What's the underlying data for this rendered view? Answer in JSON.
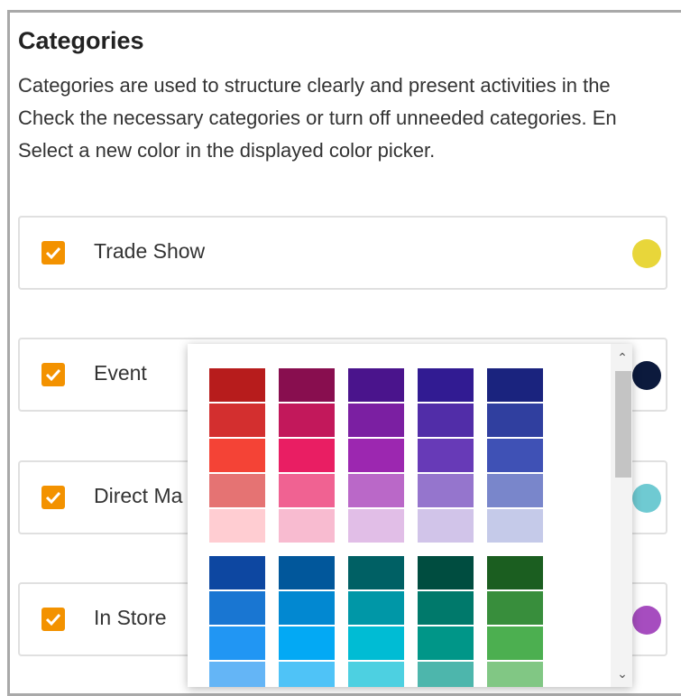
{
  "section": {
    "title": "Categories",
    "description": [
      "Categories are used to structure clearly and present activities in the",
      "Check the necessary categories or turn off unneeded categories. En",
      "Select a new color in the displayed color picker."
    ]
  },
  "categories": [
    {
      "label": "Trade Show",
      "checked": true,
      "color": "#e8d63a"
    },
    {
      "label": "Event",
      "checked": true,
      "color": "#0c1a3d"
    },
    {
      "label": "Direct Ma",
      "checked": true,
      "color": "#6fcad2"
    },
    {
      "label": "In Store",
      "checked": true,
      "color": "#a64dbf"
    }
  ],
  "picker": {
    "group1": [
      [
        "#b71c1c",
        "#d32f2f",
        "#f44336",
        "#e57373",
        "#ffcdd2"
      ],
      [
        "#880e4f",
        "#c2185b",
        "#e91e63",
        "#f06292",
        "#f8bbd0"
      ],
      [
        "#4a148c",
        "#7b1fa2",
        "#9c27b0",
        "#ba68c8",
        "#e1bee7"
      ],
      [
        "#311b92",
        "#512da8",
        "#673ab7",
        "#9575cd",
        "#d1c4e9"
      ],
      [
        "#1a237e",
        "#303f9f",
        "#3f51b5",
        "#7986cb",
        "#c5cae9"
      ]
    ],
    "group2": [
      [
        "#0d47a1",
        "#1976d2",
        "#2196f3",
        "#64b5f6"
      ],
      [
        "#01579b",
        "#0288d1",
        "#03a9f4",
        "#4fc3f7"
      ],
      [
        "#006064",
        "#0097a7",
        "#00bcd4",
        "#4dd0e1"
      ],
      [
        "#004d40",
        "#00796b",
        "#009688",
        "#4db6ac"
      ],
      [
        "#1b5e20",
        "#388e3c",
        "#4caf50",
        "#81c784"
      ]
    ],
    "scroll_up_icon": "chevron-up-icon",
    "scroll_down_icon": "chevron-down-icon"
  },
  "accent": "#f39200"
}
